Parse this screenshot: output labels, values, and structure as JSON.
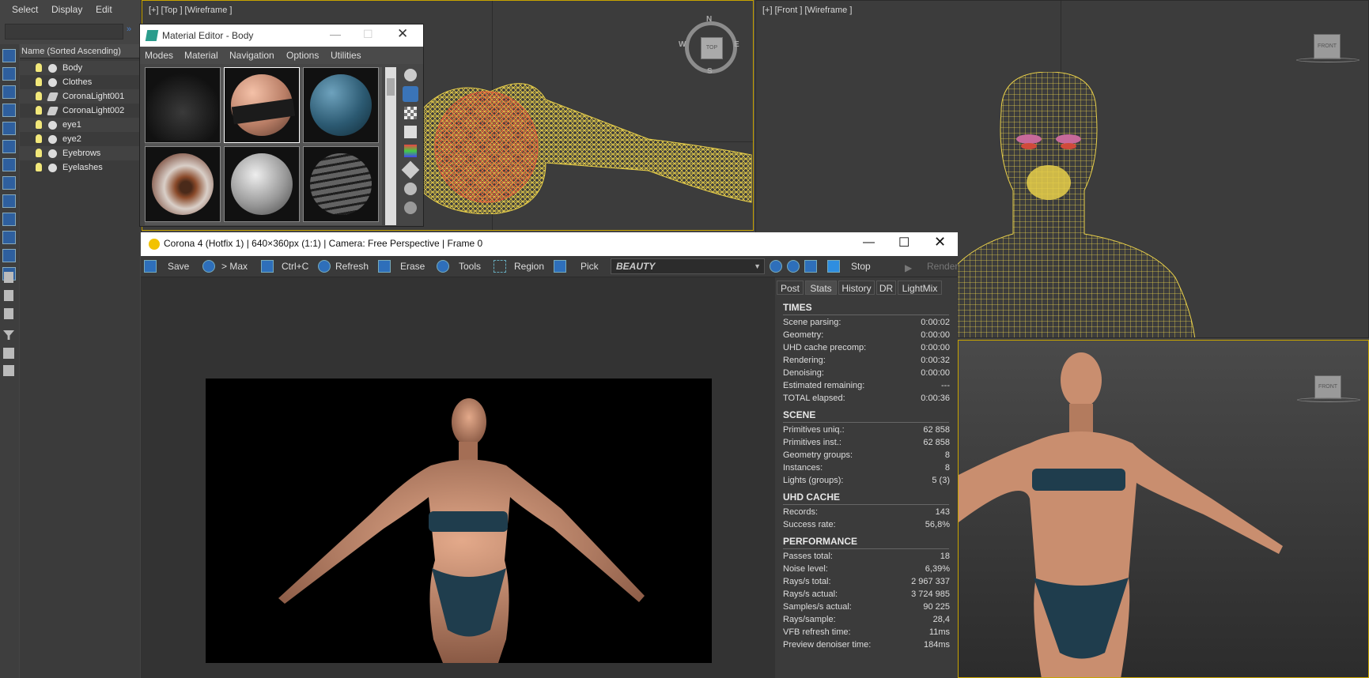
{
  "explorer": {
    "menu": [
      "Select",
      "Display",
      "Edit"
    ],
    "header": "Name (Sorted Ascending)",
    "items": [
      {
        "label": "Body",
        "type": "object"
      },
      {
        "label": "Clothes",
        "type": "object"
      },
      {
        "label": "CoronaLight001",
        "type": "light"
      },
      {
        "label": "CoronaLight002",
        "type": "light"
      },
      {
        "label": "eye1",
        "type": "object"
      },
      {
        "label": "eye2",
        "type": "object"
      },
      {
        "label": "Eyebrows",
        "type": "object"
      },
      {
        "label": "Eyelashes",
        "type": "object"
      }
    ]
  },
  "viewports": {
    "top_label": "[+] [Top ] [Wireframe ]",
    "front_label": "[+] [Front ] [Wireframe ]",
    "compass": {
      "n": "N",
      "s": "S",
      "e": "E",
      "w": "W",
      "center": "TOP"
    },
    "front_cube": "FRONT"
  },
  "material_editor": {
    "title": "Material Editor - Body",
    "menu": [
      "Modes",
      "Material",
      "Navigation",
      "Options",
      "Utilities"
    ]
  },
  "vfb": {
    "title": "Corona 4 (Hotfix 1) | 640×360px (1:1) | Camera: Free Perspective | Frame 0",
    "toolbar": {
      "save": "Save",
      "to_max": "> Max",
      "copy": "Ctrl+C",
      "refresh": "Refresh",
      "erase": "Erase",
      "tools": "Tools",
      "region": "Region",
      "pick": "Pick",
      "pass": "BEAUTY",
      "stop": "Stop",
      "render": "Render"
    },
    "tabs": [
      "Post",
      "Stats",
      "History",
      "DR",
      "LightMix"
    ],
    "active_tab": "Stats",
    "sections": [
      {
        "title": "TIMES",
        "rows": [
          {
            "k": "Scene parsing:",
            "v": "0:00:02"
          },
          {
            "k": "Geometry:",
            "v": "0:00:00"
          },
          {
            "k": "UHD cache precomp:",
            "v": "0:00:00"
          },
          {
            "k": "Rendering:",
            "v": "0:00:32"
          },
          {
            "k": "Denoising:",
            "v": "0:00:00"
          },
          {
            "k": "Estimated remaining:",
            "v": "---"
          },
          {
            "k": "TOTAL elapsed:",
            "v": "0:00:36"
          }
        ]
      },
      {
        "title": "SCENE",
        "rows": [
          {
            "k": "Primitives uniq.:",
            "v": "62 858"
          },
          {
            "k": "Primitives inst.:",
            "v": "62 858"
          },
          {
            "k": "Geometry groups:",
            "v": "8"
          },
          {
            "k": "Instances:",
            "v": "8"
          },
          {
            "k": "Lights (groups):",
            "v": "5 (3)"
          }
        ]
      },
      {
        "title": "UHD CACHE",
        "rows": [
          {
            "k": "Records:",
            "v": "143"
          },
          {
            "k": "Success rate:",
            "v": "56,8%"
          }
        ]
      },
      {
        "title": "PERFORMANCE",
        "rows": [
          {
            "k": "Passes total:",
            "v": "18"
          },
          {
            "k": "Noise level:",
            "v": "6,39%"
          },
          {
            "k": "Rays/s total:",
            "v": "2 967 337"
          },
          {
            "k": "Rays/s actual:",
            "v": "3 724 985"
          },
          {
            "k": "Samples/s actual:",
            "v": "90 225"
          },
          {
            "k": "Rays/sample:",
            "v": "28,4"
          },
          {
            "k": "VFB refresh time:",
            "v": "11ms"
          },
          {
            "k": "Preview denoiser time:",
            "v": "184ms"
          }
        ]
      }
    ]
  },
  "colors": {
    "wireframe": "#e8cf4a",
    "wireframe_red": "#e0583a",
    "accent_blue": "#2e6fba",
    "skin": "#c98e6f",
    "bikini": "#1f3d4d"
  }
}
